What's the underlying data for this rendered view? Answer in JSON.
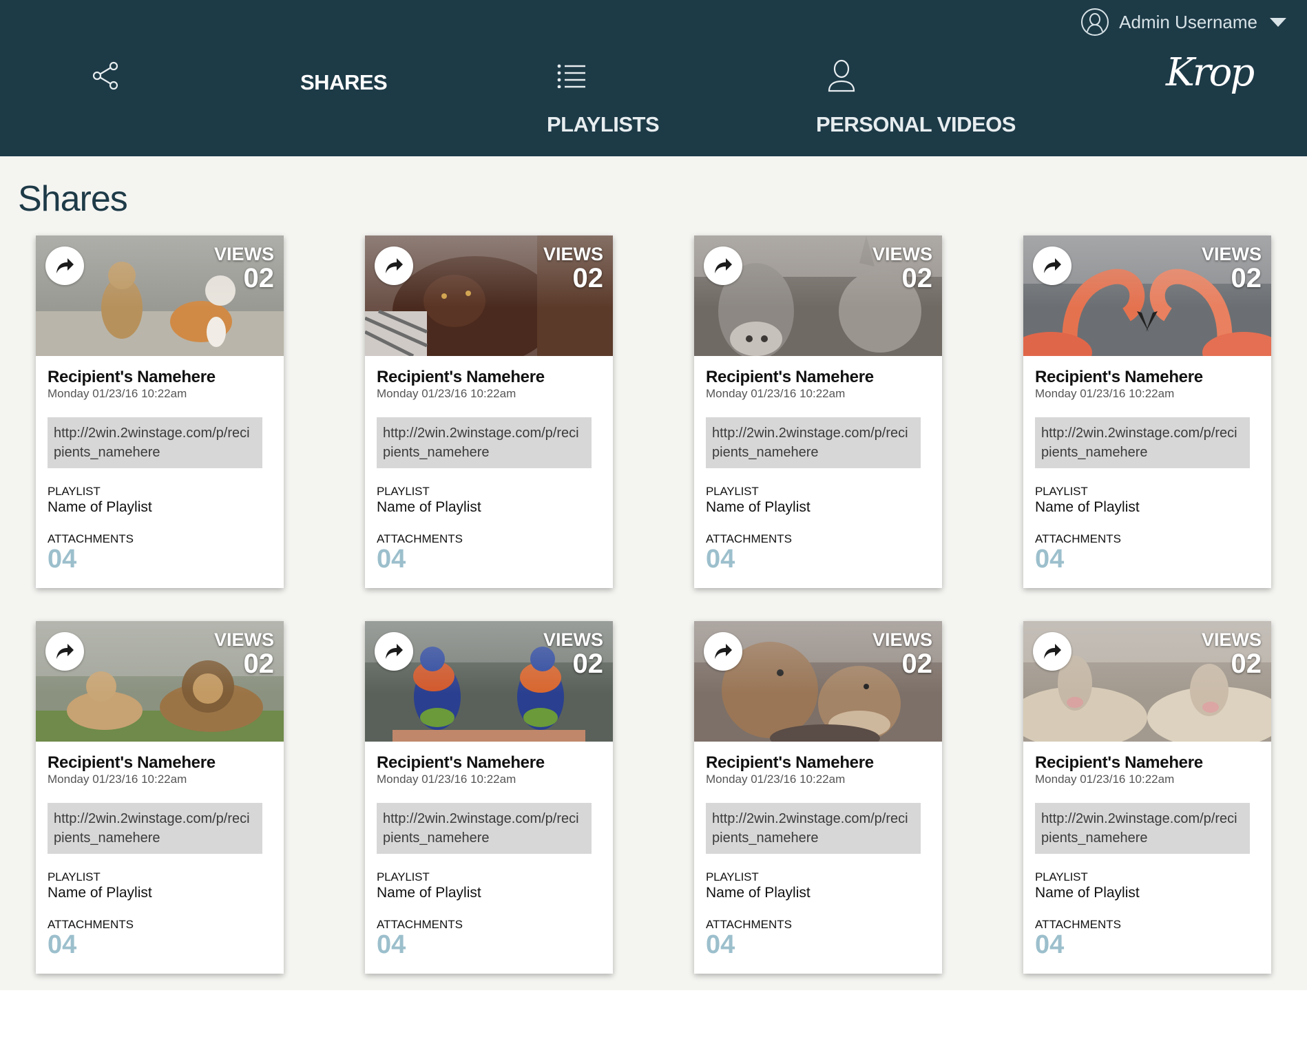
{
  "header": {
    "user_name": "Admin Username",
    "nav": {
      "shares": "SHARES",
      "playlists": "PLAYLISTS",
      "personal_videos": "PERSONAL VIDEOS"
    },
    "logo": "Krop",
    "icons": [
      "share-icon",
      "list-icon",
      "person-icon",
      "user-circle-icon",
      "caret-down-icon"
    ]
  },
  "page": {
    "title": "Shares"
  },
  "colors": {
    "header_bg": "#1d3a47",
    "content_bg": "#f4f4f1",
    "attachments_accent": "#9cbfcc",
    "link_bg": "#d7d7d7"
  },
  "cards": [
    {
      "image": "cats",
      "views_label": "VIEWS",
      "views": "02",
      "recipient": "Recipient's Namehere",
      "date": "Monday 01/23/16 10:22am",
      "url": "http://2win.2winstage.com/p/recipients_namehere",
      "playlist_label": "PLAYLIST",
      "playlist": "Name of Playlist",
      "attachments_label": "ATTACHMENTS",
      "attachments": "04"
    },
    {
      "image": "dog",
      "views_label": "VIEWS",
      "views": "02",
      "recipient": "Recipient's Namehere",
      "date": "Monday 01/23/16 10:22am",
      "url": "http://2win.2winstage.com/p/recipients_namehere",
      "playlist_label": "PLAYLIST",
      "playlist": "Name of Playlist",
      "attachments_label": "ATTACHMENTS",
      "attachments": "04"
    },
    {
      "image": "donkeys",
      "views_label": "VIEWS",
      "views": "02",
      "recipient": "Recipient's Namehere",
      "date": "Monday 01/23/16 10:22am",
      "url": "http://2win.2winstage.com/p/recipients_namehere",
      "playlist_label": "PLAYLIST",
      "playlist": "Name of Playlist",
      "attachments_label": "ATTACHMENTS",
      "attachments": "04"
    },
    {
      "image": "flamingos",
      "views_label": "VIEWS",
      "views": "02",
      "recipient": "Recipient's Namehere",
      "date": "Monday 01/23/16 10:22am",
      "url": "http://2win.2winstage.com/p/recipients_namehere",
      "playlist_label": "PLAYLIST",
      "playlist": "Name of Playlist",
      "attachments_label": "ATTACHMENTS",
      "attachments": "04"
    },
    {
      "image": "lions",
      "views_label": "VIEWS",
      "views": "02",
      "recipient": "Recipient's Namehere",
      "date": "Monday 01/23/16 10:22am",
      "url": "http://2win.2winstage.com/p/recipients_namehere",
      "playlist_label": "PLAYLIST",
      "playlist": "Name of Playlist",
      "attachments_label": "ATTACHMENTS",
      "attachments": "04"
    },
    {
      "image": "parrots",
      "views_label": "VIEWS",
      "views": "02",
      "recipient": "Recipient's Namehere",
      "date": "Monday 01/23/16 10:22am",
      "url": "http://2win.2winstage.com/p/recipients_namehere",
      "playlist_label": "PLAYLIST",
      "playlist": "Name of Playlist",
      "attachments_label": "ATTACHMENTS",
      "attachments": "04"
    },
    {
      "image": "marmots",
      "views_label": "VIEWS",
      "views": "02",
      "recipient": "Recipient's Namehere",
      "date": "Monday 01/23/16 10:22am",
      "url": "http://2win.2winstage.com/p/recipients_namehere",
      "playlist_label": "PLAYLIST",
      "playlist": "Name of Playlist",
      "attachments_label": "ATTACHMENTS",
      "attachments": "04"
    },
    {
      "image": "sheep",
      "views_label": "VIEWS",
      "views": "02",
      "recipient": "Recipient's Namehere",
      "date": "Monday 01/23/16 10:22am",
      "url": "http://2win.2winstage.com/p/recipients_namehere",
      "playlist_label": "PLAYLIST",
      "playlist": "Name of Playlist",
      "attachments_label": "ATTACHMENTS",
      "attachments": "04"
    }
  ]
}
